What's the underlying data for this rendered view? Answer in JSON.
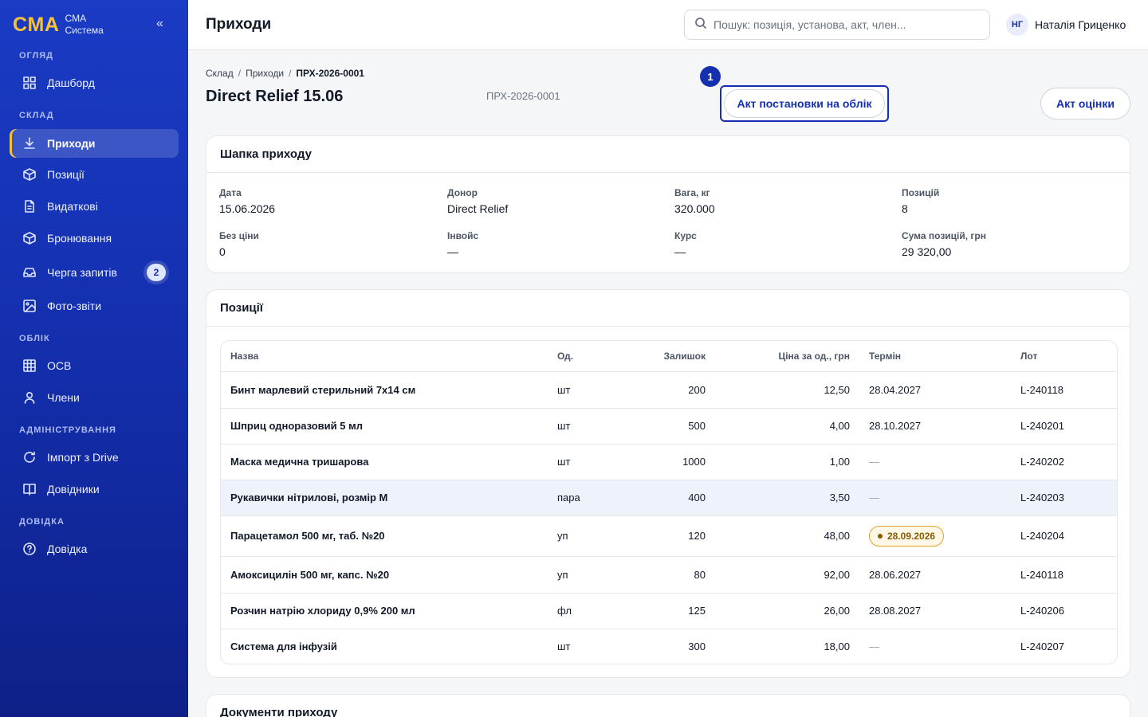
{
  "sidebar": {
    "logo": "CMA",
    "brand_line1": "CMA",
    "brand_line2": "Система",
    "collapse": "«",
    "sections": {
      "overview": "ОГЛЯД",
      "warehouse": "СКЛАД",
      "accounting": "ОБЛІК",
      "admin": "АДМІНІСТРУВАННЯ",
      "help": "ДОВІДКА"
    },
    "items": {
      "dashboard": "Дашборд",
      "receipts": "Приходи",
      "positions": "Позиції",
      "expenses": "Видаткові",
      "booking": "Бронювання",
      "queue": "Черга запитів",
      "queue_badge": "2",
      "photo": "Фото-звіти",
      "osv": "ОСВ",
      "members": "Члени",
      "import": "Імпорт з Drive",
      "refs": "Довідники",
      "help": "Довідка"
    }
  },
  "header": {
    "title": "Приходи",
    "search_placeholder": "Пошук: позиція, установа, акт, член...",
    "user_initials": "НГ",
    "user_name": "Наталія Гриценко"
  },
  "breadcrumb": {
    "b1": "Склад",
    "b2": "Приходи",
    "b3": "ПРХ-2026-0001",
    "sep": "/"
  },
  "doc": {
    "title": "Direct Relief 15.06",
    "number": "ПРХ-2026-0001",
    "step": "1",
    "btn_act_register": "Акт постановки на облік",
    "btn_act_assessment": "Акт оцінки"
  },
  "header_card": {
    "title": "Шапка приходу",
    "fields": [
      {
        "label": "Дата",
        "value": "15.06.2026"
      },
      {
        "label": "Донор",
        "value": "Direct Relief"
      },
      {
        "label": "Вага, кг",
        "value": "320.000"
      },
      {
        "label": "Позицій",
        "value": "8"
      },
      {
        "label": "Без ціни",
        "value": "0"
      },
      {
        "label": "Інвойс",
        "value": "—"
      },
      {
        "label": "Курс",
        "value": "—"
      },
      {
        "label": "Сума позицій, грн",
        "value": "29 320,00"
      }
    ]
  },
  "positions": {
    "title": "Позиції",
    "columns": {
      "name": "Назва",
      "unit": "Од.",
      "stock": "Залишок",
      "price": "Ціна за од., грн",
      "term": "Термін",
      "lot": "Лот"
    },
    "rows": [
      {
        "name": "Бинт марлевий стерильний 7х14 см",
        "unit": "шт",
        "stock": "200",
        "price": "12,50",
        "term": "28.04.2027",
        "lot": "L-240118"
      },
      {
        "name": "Шприц одноразовий 5 мл",
        "unit": "шт",
        "stock": "500",
        "price": "4,00",
        "term": "28.10.2027",
        "lot": "L-240201"
      },
      {
        "name": "Маска медична тришарова",
        "unit": "шт",
        "stock": "1000",
        "price": "1,00",
        "term": "—",
        "lot": "L-240202"
      },
      {
        "name": "Рукавички нітрилові, розмір M",
        "unit": "пара",
        "stock": "400",
        "price": "3,50",
        "term": "—",
        "lot": "L-240203"
      },
      {
        "name": "Парацетамол 500 мг, таб. №20",
        "unit": "уп",
        "stock": "120",
        "price": "48,00",
        "term": "28.09.2026",
        "lot": "L-240204"
      },
      {
        "name": "Амоксицилін 500 мг, капс. №20",
        "unit": "уп",
        "stock": "80",
        "price": "92,00",
        "term": "28.06.2027",
        "lot": "L-240118"
      },
      {
        "name": "Розчин натрію хлориду 0,9% 200 мл",
        "unit": "фл",
        "stock": "125",
        "price": "26,00",
        "term": "28.08.2027",
        "lot": "L-240206"
      },
      {
        "name": "Система для інфузій",
        "unit": "шт",
        "stock": "300",
        "price": "18,00",
        "term": "—",
        "lot": "L-240207"
      }
    ]
  },
  "documents": {
    "title": "Документи приходу"
  },
  "colors": {
    "accent": "#1430b0",
    "brand_yellow": "#f5c23a",
    "warning": "#e2a52c"
  },
  "icons": [
    "grid-icon",
    "download-icon",
    "box-icon",
    "file-icon",
    "inbox-icon",
    "image-icon",
    "table-icon",
    "user-icon",
    "refresh-icon",
    "book-icon",
    "help-circle-icon",
    "search-icon"
  ]
}
